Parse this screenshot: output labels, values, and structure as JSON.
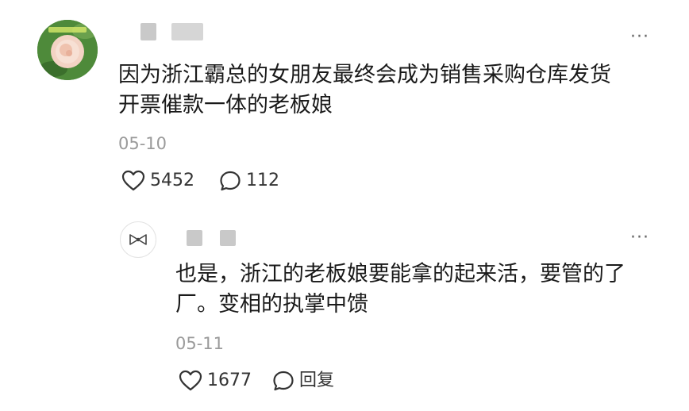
{
  "comment": {
    "avatar_icon": "rose-avatar",
    "more_label": "···",
    "text_line1": "因为浙江霸总的女朋友最终会成为销售采购仓库发货",
    "text_line2": "开票催款一体的老板娘",
    "date": "05-10",
    "like_count": "5452",
    "reply_count": "112"
  },
  "reply": {
    "avatar_icon": "bow-avatar",
    "more_label": "···",
    "text_line1": "也是，浙江的老板娘要能拿的起来活，要管的了",
    "text_line2": "厂。变相的执掌中馈",
    "date": "05-11",
    "like_count": "1677",
    "reply_label": "回复"
  },
  "colors": {
    "text": "#1a1a1a",
    "muted": "#9a9a9a",
    "blur": "#c9c9c9"
  }
}
